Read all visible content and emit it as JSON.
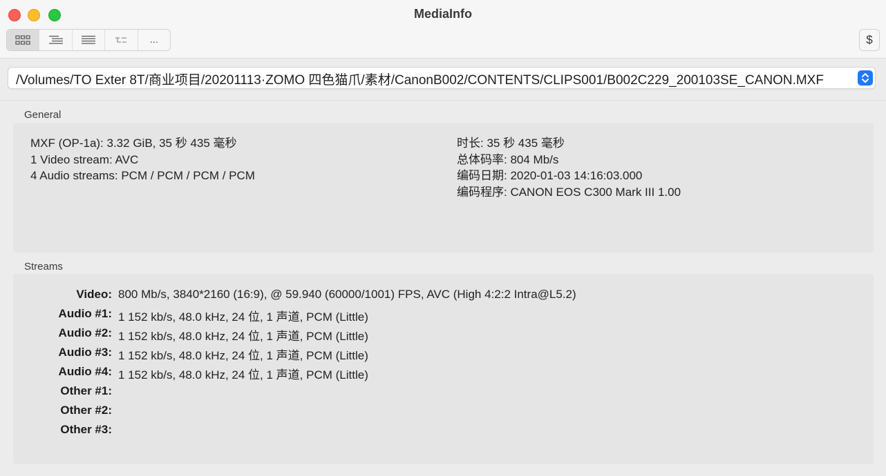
{
  "window": {
    "title": "MediaInfo"
  },
  "toolbar": {
    "view_buttons": [
      {
        "icon": "grid-view-icon"
      },
      {
        "icon": "outline-view-icon"
      },
      {
        "icon": "list-view-icon"
      },
      {
        "icon": "tree-view-icon"
      },
      {
        "label": "..."
      }
    ],
    "dollar_label": "$"
  },
  "file_path": "/Volumes/TO Exter 8T/商业项目/20201113·ZOMO 四色猫爪/素材/CanonB002/CONTENTS/CLIPS001/B002C229_200103SE_CANON.MXF",
  "general": {
    "label": "General",
    "left_lines": [
      "MXF (OP-1a): 3.32 GiB, 35 秒 435 毫秒",
      "1 Video stream: AVC",
      "4 Audio streams: PCM / PCM / PCM / PCM"
    ],
    "right_lines": [
      "时长: 35 秒 435 毫秒",
      "总体码率: 804 Mb/s",
      "编码日期: 2020-01-03 14:16:03.000",
      "编码程序: CANON EOS C300 Mark III 1.00"
    ]
  },
  "streams": {
    "label": "Streams",
    "rows": [
      {
        "label": "Video:",
        "value": "800 Mb/s, 3840*2160 (16:9), @ 59.940 (60000/1001) FPS, AVC (High 4:2:2 Intra@L5.2)"
      },
      {
        "label": "Audio #1:",
        "value": "1 152 kb/s, 48.0 kHz, 24 位, 1 声道, PCM (Little)"
      },
      {
        "label": "Audio #2:",
        "value": "1 152 kb/s, 48.0 kHz, 24 位, 1 声道, PCM (Little)"
      },
      {
        "label": "Audio #3:",
        "value": "1 152 kb/s, 48.0 kHz, 24 位, 1 声道, PCM (Little)"
      },
      {
        "label": "Audio #4:",
        "value": "1 152 kb/s, 48.0 kHz, 24 位, 1 声道, PCM (Little)"
      },
      {
        "label": "Other #1:",
        "value": ""
      },
      {
        "label": "Other #2:",
        "value": ""
      },
      {
        "label": "Other #3:",
        "value": ""
      }
    ]
  },
  "colors": {
    "close": "#fe5f57",
    "minimize": "#febc2e",
    "zoom": "#28c840",
    "accent": "#1f78ff"
  }
}
